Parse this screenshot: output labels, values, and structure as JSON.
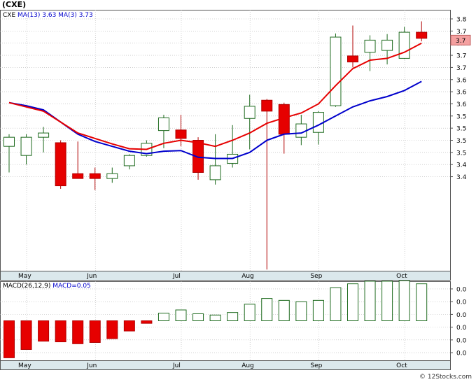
{
  "title": "(CXE)",
  "credit": "© 12Stocks.com",
  "colors": {
    "up_fill": "#ffffff",
    "up_stroke": "#1f6b1f",
    "down_fill": "#e60000",
    "down_stroke": "#b00000",
    "ma13": "#e60000",
    "ma3": "#0000cc",
    "grid": "#b5b5b5",
    "axis_bg": "#dbe8ec",
    "price_tag_bg": "#f4a0a0"
  },
  "price_panel": {
    "legend": {
      "symbol": "CXE",
      "ma13_label": "MA(13)",
      "ma13_value": "3.63",
      "ma3_label": "MA(3)",
      "ma3_value": "3.73"
    },
    "ylim": [
      3.385,
      3.815
    ],
    "y_ticks": [
      "3.8",
      "3.7",
      "3.7",
      "3.7",
      "3.7",
      "3.6",
      "3.6",
      "3.6",
      "3.5",
      "3.5",
      "3.5",
      "3.5",
      "3.4",
      "3.4"
    ],
    "y_tick_values": [
      3.8,
      3.78,
      3.76,
      3.74,
      3.72,
      3.7,
      3.68,
      3.66,
      3.64,
      3.62,
      3.6,
      3.58,
      3.56,
      3.54
    ],
    "last_price_tag": "3.7",
    "last_price_value": 3.765
  },
  "macd_panel": {
    "legend": {
      "label": "MACD(26,12,9)",
      "macd_label": "MACD=0.05"
    },
    "y_ticks": [
      "0.0",
      "0.0",
      "0.0",
      "0.0",
      "0.0",
      "0.0"
    ],
    "y_tick_values": [
      0.05,
      0.03,
      0.01,
      -0.01,
      -0.03,
      -0.05
    ],
    "ylim": [
      -0.062,
      0.062
    ]
  },
  "x_labels": [
    {
      "label": "May",
      "index": 1
    },
    {
      "label": "Jun",
      "index": 5
    },
    {
      "label": "Jul",
      "index": 10
    },
    {
      "label": "Aug",
      "index": 14
    },
    {
      "label": "Sep",
      "index": 18
    },
    {
      "label": "Oct",
      "index": 23
    }
  ],
  "chart_data": {
    "type": "candlestick",
    "n": 25,
    "ohlc": [
      {
        "o": 3.59,
        "h": 3.61,
        "l": 3.547,
        "c": 3.605
      },
      {
        "o": 3.575,
        "h": 3.61,
        "l": 3.56,
        "c": 3.605
      },
      {
        "o": 3.605,
        "h": 3.622,
        "l": 3.58,
        "c": 3.612
      },
      {
        "o": 3.596,
        "h": 3.6,
        "l": 3.52,
        "c": 3.525
      },
      {
        "o": 3.545,
        "h": 3.598,
        "l": 3.54,
        "c": 3.537
      },
      {
        "o": 3.545,
        "h": 3.555,
        "l": 3.518,
        "c": 3.537
      },
      {
        "o": 3.537,
        "h": 3.555,
        "l": 3.53,
        "c": 3.545
      },
      {
        "o": 3.558,
        "h": 3.577,
        "l": 3.552,
        "c": 3.575
      },
      {
        "o": 3.575,
        "h": 3.6,
        "l": 3.573,
        "c": 3.595
      },
      {
        "o": 3.616,
        "h": 3.642,
        "l": 3.587,
        "c": 3.637
      },
      {
        "o": 3.617,
        "h": 3.642,
        "l": 3.59,
        "c": 3.603
      },
      {
        "o": 3.6,
        "h": 3.605,
        "l": 3.535,
        "c": 3.547
      },
      {
        "o": 3.535,
        "h": 3.61,
        "l": 3.527,
        "c": 3.558
      },
      {
        "o": 3.562,
        "h": 3.625,
        "l": 3.555,
        "c": 3.577
      },
      {
        "o": 3.636,
        "h": 3.675,
        "l": 3.585,
        "c": 3.656
      },
      {
        "o": 3.666,
        "h": 3.668,
        "l": 3.387,
        "c": 3.648
      },
      {
        "o": 3.659,
        "h": 3.662,
        "l": 3.578,
        "c": 3.61
      },
      {
        "o": 3.605,
        "h": 3.642,
        "l": 3.592,
        "c": 3.627
      },
      {
        "o": 3.613,
        "h": 3.648,
        "l": 3.593,
        "c": 3.646
      },
      {
        "o": 3.657,
        "h": 3.776,
        "l": 3.655,
        "c": 3.77
      },
      {
        "o": 3.739,
        "h": 3.789,
        "l": 3.72,
        "c": 3.729
      },
      {
        "o": 3.745,
        "h": 3.773,
        "l": 3.714,
        "c": 3.765
      },
      {
        "o": 3.748,
        "h": 3.775,
        "l": 3.725,
        "c": 3.765
      },
      {
        "o": 3.735,
        "h": 3.787,
        "l": 3.734,
        "c": 3.778
      },
      {
        "o": 3.778,
        "h": 3.796,
        "l": 3.763,
        "c": 3.768
      }
    ],
    "ma13": [
      3.662,
      3.657,
      3.65,
      3.63,
      3.61,
      3.598,
      3.59,
      3.582,
      3.578,
      3.582,
      3.583,
      3.572,
      3.57,
      3.57,
      3.58,
      3.6,
      3.61,
      3.612,
      3.625,
      3.64,
      3.655,
      3.665,
      3.672,
      3.682,
      3.697
    ],
    "ma13_start": 0,
    "ma3": [
      3.66,
      3.642,
      3.615,
      3.595,
      3.578,
      3.568,
      3.557,
      3.554,
      3.561,
      3.57,
      3.586,
      3.595,
      3.618,
      3.635,
      3.705,
      3.741,
      3.764,
      3.772
    ],
    "ma3_start": 0,
    "ma13_points_index": [
      0,
      1,
      2,
      3,
      4,
      5,
      6,
      7,
      8,
      9,
      10,
      11,
      12,
      13,
      14,
      15,
      16,
      17,
      18,
      19,
      20,
      21,
      22,
      23,
      24
    ],
    "macd_hist": [
      -0.058,
      -0.045,
      -0.032,
      -0.033,
      -0.036,
      -0.034,
      -0.028,
      -0.016,
      -0.004,
      0.012,
      0.017,
      0.011,
      0.009,
      0.013,
      0.026,
      0.035,
      0.032,
      0.03,
      0.032,
      0.052,
      0.058,
      0.062,
      0.062,
      0.063,
      0.058
    ]
  }
}
